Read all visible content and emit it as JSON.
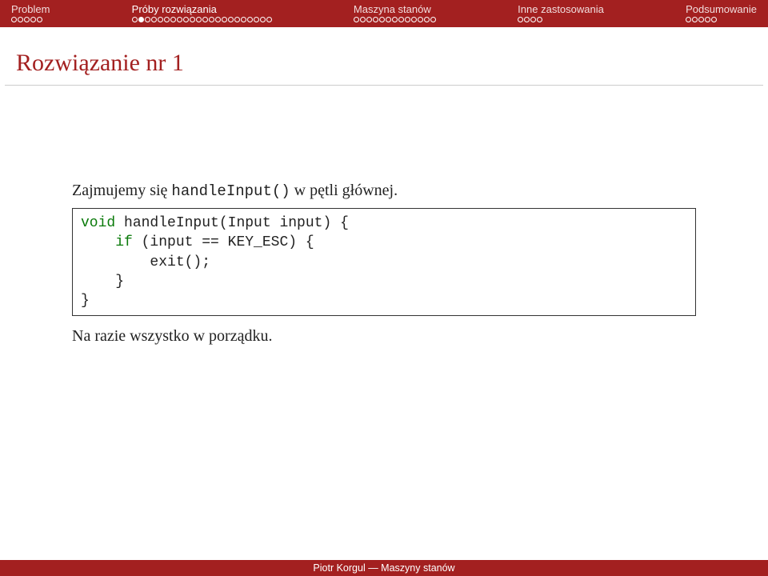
{
  "nav": [
    {
      "label": "Problem",
      "total": 5,
      "current": -1
    },
    {
      "label": "Próby rozwiązania",
      "total": 22,
      "current": 1
    },
    {
      "label": "Maszyna stanów",
      "total": 13,
      "current": -1
    },
    {
      "label": "Inne zastosowania",
      "total": 4,
      "current": -1
    },
    {
      "label": "Podsumowanie",
      "total": 5,
      "current": -1
    }
  ],
  "title": "Rozwiązanie nr 1",
  "body": {
    "intro_pre": "Zajmujemy się ",
    "intro_fn": "handleInput()",
    "intro_post": " w pętli głównej.",
    "code_kw_void": "void",
    "code_l1_rest": " handleInput(Input input) {",
    "code_l2_pre": "    ",
    "code_kw_if": "if",
    "code_l2_rest": " (input == KEY_ESC) {",
    "code_l3": "        exit();",
    "code_l4": "    }",
    "code_l5": "}",
    "outro": "Na razie wszystko w porządku."
  },
  "footer": "Piotr Korgul — Maszyny stanów"
}
